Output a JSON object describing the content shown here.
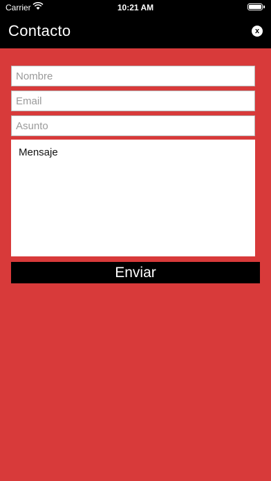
{
  "status_bar": {
    "carrier": "Carrier",
    "time": "10:21 AM",
    "wifi_icon": "wifi-icon",
    "battery_icon": "battery-icon"
  },
  "header": {
    "title": "Contacto",
    "close_label": "x",
    "close_icon": "close-icon"
  },
  "form": {
    "name_placeholder": "Nombre",
    "email_placeholder": "Email",
    "subject_placeholder": "Asunto",
    "message_text": "Mensaje",
    "send_label": "Enviar"
  },
  "colors": {
    "background": "#d83a3a",
    "header": "#000000",
    "button": "#000000"
  }
}
